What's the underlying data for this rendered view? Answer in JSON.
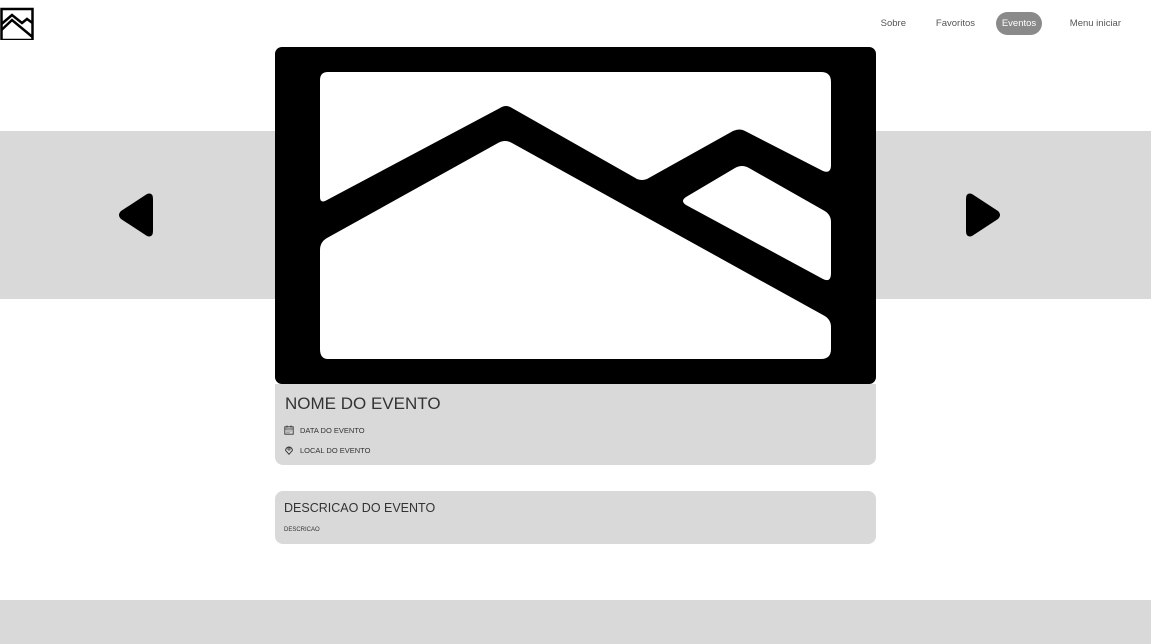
{
  "nav": {
    "items": [
      {
        "label": "Sobre",
        "active": false
      },
      {
        "label": "Favoritos",
        "active": false
      },
      {
        "label": "Eventos",
        "active": true
      },
      {
        "label": "Menu iniciar",
        "active": false
      }
    ],
    "active_color": "#8a8a8a"
  },
  "icons": {
    "logo": "image-placeholder-icon",
    "hero": "image-placeholder-icon",
    "prev": "arrow-left-icon",
    "next": "arrow-right-icon",
    "date": "calendar-icon",
    "location": "location-pin-icon"
  },
  "event": {
    "name": "NOME DO EVENTO",
    "date": "DATA DO EVENTO",
    "location": "LOCAL DO EVENTO"
  },
  "description": {
    "title": "DESCRICAO DO EVENTO",
    "body": "DESCRICAO"
  },
  "colors": {
    "band": "#d9d9d9",
    "page": "#ffffff",
    "icon": "#000000"
  }
}
